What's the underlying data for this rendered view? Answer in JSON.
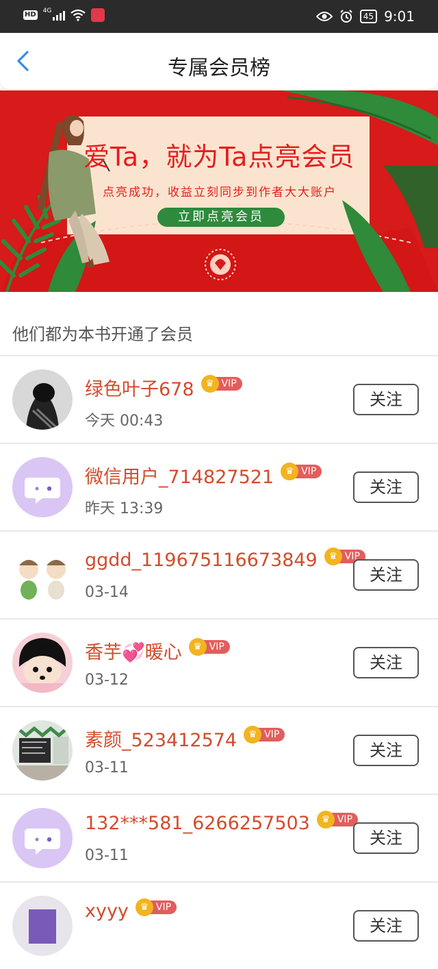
{
  "status_bar": {
    "hd": "HD",
    "network": "4G",
    "battery": "45",
    "time": "9:01"
  },
  "header": {
    "title": "专属会员榜"
  },
  "banner": {
    "headline": "爱Ta，就为Ta点亮会员",
    "subtitle": "点亮成功，收益立刻同步到作者大大账户",
    "cta": "立即点亮会员"
  },
  "section_label": "他们都为本书开通了会员",
  "vip_label": "VIP",
  "follow_label": "关注",
  "members": [
    {
      "name": "绿色叶子678",
      "time": "今天 00:43",
      "avatar": "photo-dark"
    },
    {
      "name": "微信用户_714827521",
      "time": "昨天 13:39",
      "avatar": "default-chat"
    },
    {
      "name": "ggdd_119675116673849",
      "time": "03-14",
      "avatar": "cartoon-pair"
    },
    {
      "name": "香芋💞暖心",
      "time": "03-12",
      "avatar": "cartoon-face"
    },
    {
      "name": "素颜_523412574",
      "time": "03-11",
      "avatar": "classroom"
    },
    {
      "name": "132***581_6266257503",
      "time": "03-11",
      "avatar": "default-chat"
    },
    {
      "name": "xyyy",
      "time": "",
      "avatar": "photo-purple"
    }
  ],
  "colors": {
    "name": "#d24c2e",
    "banner_red": "#d71a1a",
    "cta_green": "#2e8a3c",
    "vip_gold": "#f2b41f",
    "vip_red": "#e35d5d",
    "back_blue": "#2f8ee8"
  }
}
